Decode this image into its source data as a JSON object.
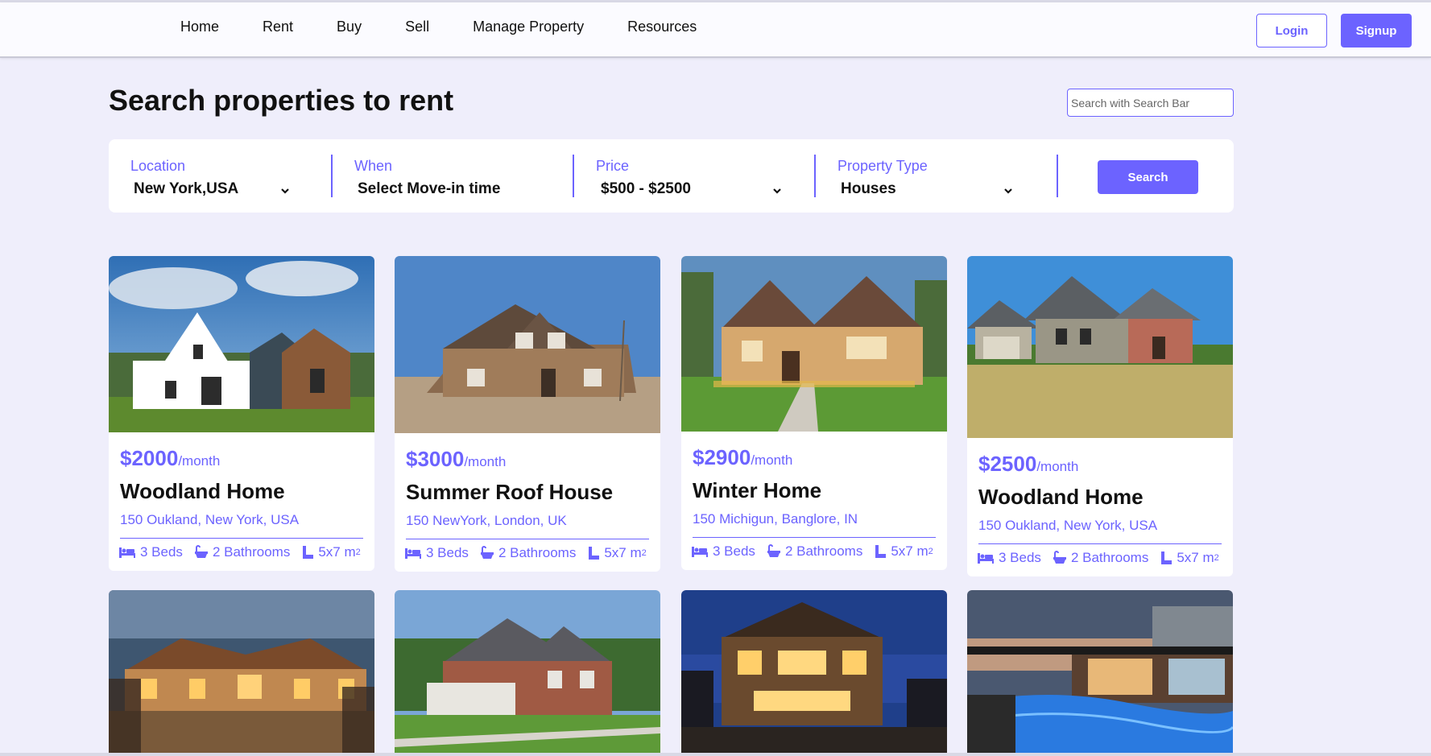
{
  "nav": {
    "links": [
      "Home",
      "Rent",
      "Buy",
      "Sell",
      "Manage Property",
      "Resources"
    ],
    "login_label": "Login",
    "signup_label": "Signup"
  },
  "page": {
    "title": "Search properties to rent",
    "search_placeholder": "Search with Search Bar"
  },
  "filters": {
    "location": {
      "label": "Location",
      "value": "New York,USA"
    },
    "when": {
      "label": "When",
      "value": "Select Move-in time"
    },
    "price": {
      "label": "Price",
      "value": "$500 - $2500"
    },
    "property_type": {
      "label": "Property Type",
      "value": "Houses"
    },
    "search_label": "Search"
  },
  "listings": [
    {
      "price": "$2000",
      "period": "/month",
      "name": "Woodland Home",
      "address": "150 Oukland, New York, USA",
      "beds": "3 Beds",
      "baths": "2 Bathrooms",
      "area": "5x7 m",
      "area_sup": "2"
    },
    {
      "price": "$3000",
      "period": "/month",
      "name": "Summer Roof House",
      "address": "150 NewYork, London, UK",
      "beds": "3 Beds",
      "baths": "2 Bathrooms",
      "area": "5x7 m",
      "area_sup": "2"
    },
    {
      "price": "$2900",
      "period": "/month",
      "name": "Winter Home",
      "address": "150 Michigun, Banglore, IN",
      "beds": "3 Beds",
      "baths": "2 Bathrooms",
      "area": "5x7 m",
      "area_sup": "2"
    },
    {
      "price": "$2500",
      "period": "/month",
      "name": "Woodland Home",
      "address": "150 Oukland, New York, USA",
      "beds": "3 Beds",
      "baths": "2 Bathrooms",
      "area": "5x7 m",
      "area_sup": "2"
    }
  ],
  "colors": {
    "accent": "#6c63ff",
    "background": "#efeefb",
    "card": "#ffffff"
  },
  "icons": [
    "bed-icon",
    "bathtub-icon",
    "ruler-icon",
    "chevron-down-icon"
  ]
}
